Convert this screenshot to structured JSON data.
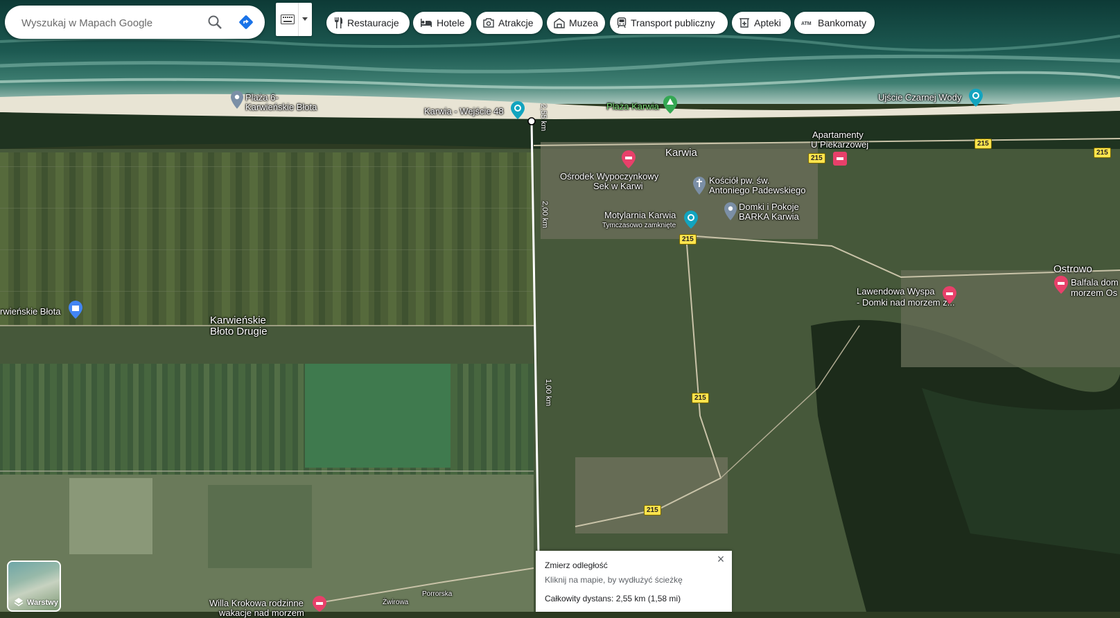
{
  "search": {
    "placeholder": "Wyszukaj w Mapach Google"
  },
  "icons": {
    "search": "search-icon",
    "directions": "directions-icon",
    "keyboard": "keyboard-icon",
    "dropdown": "chevron-down-icon"
  },
  "chips": [
    {
      "label": "Restauracje",
      "icon": "restaurant-icon"
    },
    {
      "label": "Hotele",
      "icon": "hotel-icon"
    },
    {
      "label": "Atrakcje",
      "icon": "camera-icon"
    },
    {
      "label": "Muzea",
      "icon": "museum-icon"
    },
    {
      "label": "Transport publiczny",
      "icon": "transit-icon"
    },
    {
      "label": "Apteki",
      "icon": "pharmacy-icon"
    },
    {
      "label": "Bankomaty",
      "icon": "atm-icon"
    }
  ],
  "places": {
    "plaza6_line1": "Plaża 6-",
    "plaza6_line2": "Karwieńskie Błota",
    "karwia_wejscie": "Karwia - Wejście 48",
    "plaza_karwia": "Plaża Karwia",
    "ujscie": "Ujście Czarnej Wody",
    "apartamenty_line1": "Apartamenty",
    "apartamenty_line2": "U Piekarzowej",
    "karwia": "Karwia",
    "osrodek_line1": "Ośrodek Wypoczynkowy",
    "osrodek_line2": "Sek w Karwi",
    "kosciol_line1": "Kościół pw. św.",
    "kosciol_line2": "Antoniego Padewskiego",
    "domki_barka_line1": "Domki i Pokoje",
    "domki_barka_line2": "BARKA Karwia",
    "motylarnia": "Motylarnia Karwia",
    "motylarnia_status": "Tymczasowo zamknięte",
    "ostrowo": "Ostrowo",
    "lawendowa_line1": "Lawendowa Wyspa",
    "lawendowa_line2": "- Domki nad morzem z...",
    "balfala_line1": "Balfala dom",
    "balfala_line2": "morzem Os",
    "karw_blota": "rwieńskie Błota",
    "karw_blota_drugie_line1": "Karwieńskie",
    "karw_blota_drugie_line2": "Błoto Drugie",
    "willa_line1": "Willa Krokowa rodzinne",
    "willa_line2": "wakacje nad morzem",
    "street_zwirowa": "Żwirowa",
    "street_porrorska": "Porrorska"
  },
  "roads": {
    "r215": "215"
  },
  "measure_labels": {
    "d1": "2,55 km",
    "d2": "2,00 km",
    "d3": "1,00 km"
  },
  "measure": {
    "title": "Zmierz odległość",
    "subtitle": "Kliknij na mapie, by wydłużyć ścieżkę",
    "total": "Całkowity dystans: 2,55 km (1,58 mi)"
  },
  "layers": {
    "label": "Warstwy"
  },
  "colors": {
    "hotel_pin": "#e8406a",
    "attraction_pin": "#12a4bf",
    "park_pin": "#34a853",
    "generic_pin": "#7b8fa6",
    "directions": "#1a73e8"
  }
}
